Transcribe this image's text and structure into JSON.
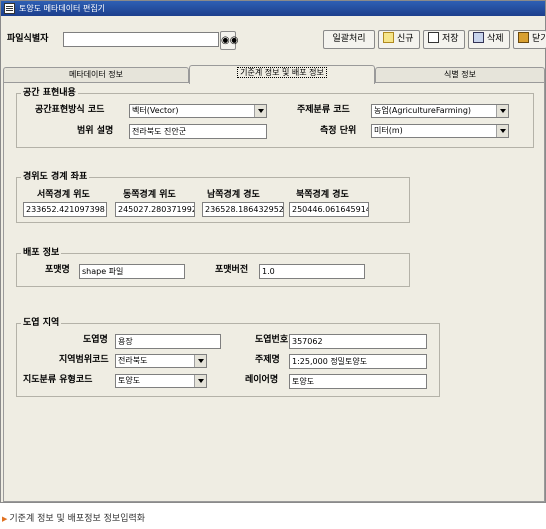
{
  "window": {
    "title": "토양도 메타데이터 편집기"
  },
  "toolbar": {
    "file_id_label": "파일식별자",
    "file_id_value": "",
    "batch_button": "일괄처리",
    "new_button": "신규",
    "save_button": "저장",
    "delete_button": "삭제",
    "close_button": "닫기"
  },
  "tabs": [
    {
      "label": "메타데이터 정보",
      "active": false
    },
    {
      "label": "기준계 정보 및 배포 정보",
      "active": true
    },
    {
      "label": "식별 정보",
      "active": false
    }
  ],
  "spatial": {
    "title": "공간 표현내용",
    "repr_code_label": "공간표현방식 코드",
    "repr_code_value": "벡터(Vector)",
    "topic_code_label": "주제분류 코드",
    "topic_code_value": "농업(AgricultureFarming)",
    "extent_desc_label": "범위 설명",
    "extent_desc_value": "전라북도 진안군",
    "unit_label": "측정 단위",
    "unit_value": "미터(m)"
  },
  "bounds": {
    "title": "경위도 경계 좌표",
    "west_label": "서쪽경계 위도",
    "west_value": "233652.421097398",
    "east_label": "동쪽경계 위도",
    "east_value": "245027.280371992",
    "south_label": "남쪽경계 경도",
    "south_value": "236528.186432952",
    "north_label": "북쪽경계 경도",
    "north_value": "250446.061645914"
  },
  "distribution": {
    "title": "배포 정보",
    "format_name_label": "포맷명",
    "format_name_value": "shape 파일",
    "format_version_label": "포맷버전",
    "format_version_value": "1.0"
  },
  "map_sheet": {
    "title": "도엽 지역",
    "sheet_name_label": "도엽명",
    "sheet_name_value": "용장",
    "sheet_no_label": "도엽번호",
    "sheet_no_value": "357062",
    "region_code_label": "지역범위코드",
    "region_code_value": "전라북도",
    "scale_label": "주제명",
    "scale_value": "1:25,000 정밀토양도",
    "map_type_label": "지도분류 유형코드",
    "map_type_value": "토양도",
    "layer_label": "레이어명",
    "layer_value": "토양도"
  },
  "caption": "기준계 정보 및 배포정보 정보입력화"
}
